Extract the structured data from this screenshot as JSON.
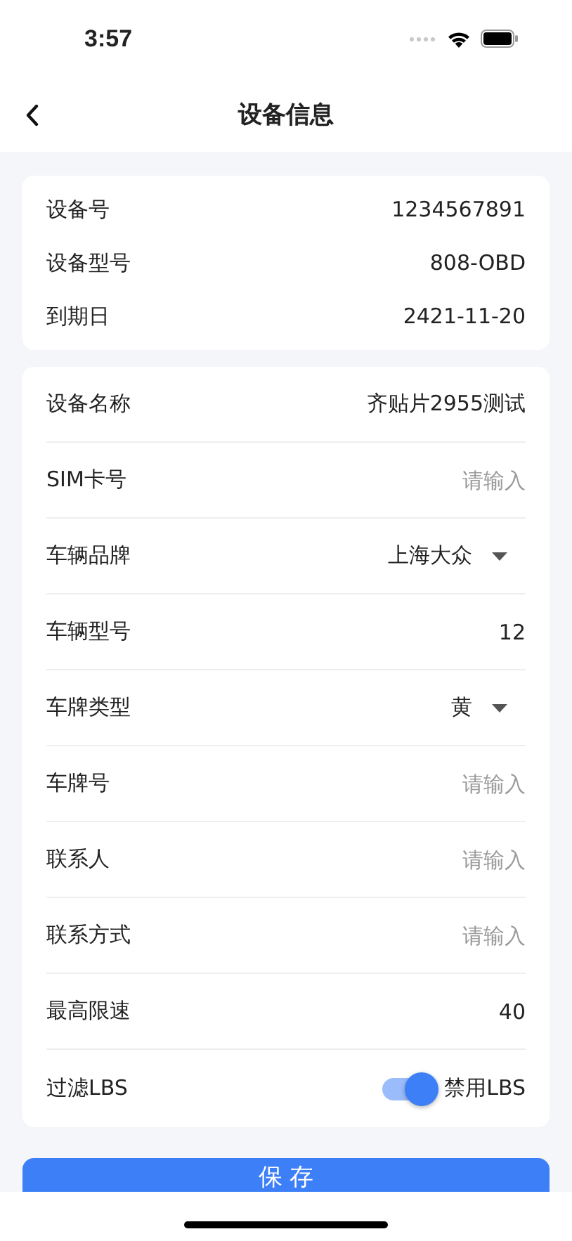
{
  "status_bar": {
    "time": "3:57"
  },
  "nav": {
    "title": "设备信息"
  },
  "info": [
    {
      "label": "设备号",
      "value": "1234567891"
    },
    {
      "label": "设备型号",
      "value": "808-OBD"
    },
    {
      "label": "到期日",
      "value": "2421-11-20"
    }
  ],
  "form": [
    {
      "kind": "text",
      "label": "设备名称",
      "value": "齐贴片2955测试"
    },
    {
      "kind": "input",
      "label": "SIM卡号",
      "placeholder": "请输入"
    },
    {
      "kind": "select",
      "label": "车辆品牌",
      "value": "上海大众"
    },
    {
      "kind": "text",
      "label": "车辆型号",
      "value": "12"
    },
    {
      "kind": "select",
      "label": "车牌类型",
      "value": "黄"
    },
    {
      "kind": "input",
      "label": "车牌号",
      "placeholder": "请输入"
    },
    {
      "kind": "input",
      "label": "联系人",
      "placeholder": "请输入"
    },
    {
      "kind": "input",
      "label": "联系方式",
      "placeholder": "请输入"
    },
    {
      "kind": "text",
      "label": "最高限速",
      "value": "40"
    },
    {
      "kind": "toggle",
      "label": "过滤LBS",
      "on": true,
      "value": "禁用LBS"
    }
  ],
  "save_button": "保 存"
}
